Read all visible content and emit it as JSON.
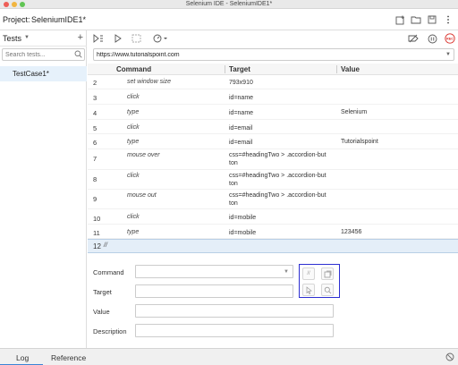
{
  "window": {
    "title": "Selenium IDE - SeleniumIDE1*"
  },
  "project": {
    "label": "Project:",
    "name": "SeleniumIDE1*",
    "icons": [
      "new-project-icon",
      "open-project-icon",
      "save-project-icon",
      "more-options-icon"
    ]
  },
  "sidebar": {
    "tests_label": "Tests",
    "search_placeholder": "Search tests...",
    "tests": [
      "TestCase1*"
    ]
  },
  "toolbar": {
    "icons": [
      "run-all-tests-icon",
      "run-current-test-icon",
      "step-over-icon",
      "test-speed-icon",
      "disable-breakpoints-icon",
      "pause-on-exceptions-icon",
      "record-icon"
    ],
    "record_label": "REC"
  },
  "url": {
    "value": "https://www.tutorialspoint.com"
  },
  "table": {
    "headers": {
      "command": "Command",
      "target": "Target",
      "value": "Value"
    },
    "rows": [
      {
        "num": "2",
        "command": "set window size",
        "target": "793x910",
        "value": ""
      },
      {
        "num": "3",
        "command": "click",
        "target": "id=name",
        "value": ""
      },
      {
        "num": "4",
        "command": "type",
        "target": "id=name",
        "value": "Selenium"
      },
      {
        "num": "5",
        "command": "click",
        "target": "id=email",
        "value": ""
      },
      {
        "num": "6",
        "command": "type",
        "target": "id=email",
        "value": "Tutorialspoint"
      },
      {
        "num": "7",
        "command": "mouse over",
        "target": "css=#headingTwo > .accordion-but",
        "target2": "ton",
        "value": ""
      },
      {
        "num": "8",
        "command": "click",
        "target": "css=#headingTwo > .accordion-but",
        "target2": "ton",
        "value": ""
      },
      {
        "num": "9",
        "command": "mouse out",
        "target": "css=#headingTwo > .accordion-but",
        "target2": "ton",
        "value": ""
      },
      {
        "num": "10",
        "command": "click",
        "target": "id=mobile",
        "value": ""
      },
      {
        "num": "11",
        "command": "type",
        "target": "id=mobile",
        "value": "123456"
      },
      {
        "num": "12",
        "command": "//",
        "target": "",
        "value": ""
      }
    ]
  },
  "editor": {
    "command_label": "Command",
    "target_label": "Target",
    "value_label": "Value",
    "description_label": "Description",
    "comment_symbol": "//"
  },
  "bottom": {
    "log": "Log",
    "reference": "Reference"
  },
  "colors": {
    "highlight_box": "#2d2fd1",
    "selected_row": "#e4eef8",
    "record_red": "#d9312b",
    "active_tab": "#3a84d6"
  }
}
